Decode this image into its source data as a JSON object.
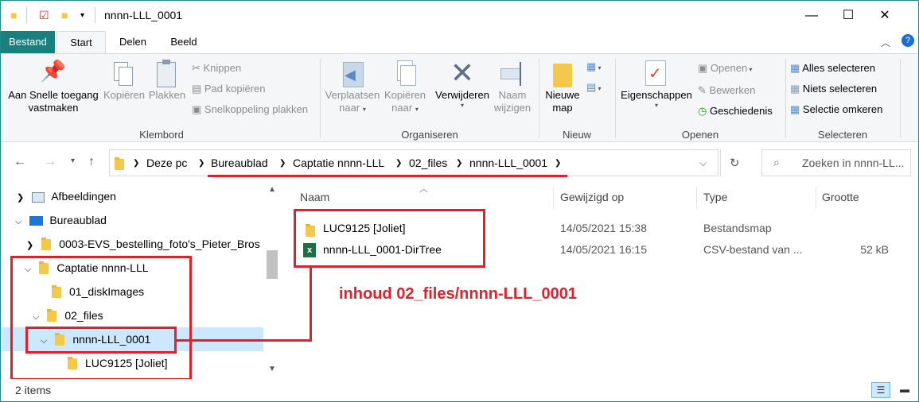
{
  "window": {
    "title": "nnnn-LLL_0001",
    "minimize": "—",
    "maximize": "☐",
    "close": "✕"
  },
  "tabs": [
    "Bestand",
    "Start",
    "Delen",
    "Beeld"
  ],
  "ribbon": {
    "pin": {
      "line1": "Aan Snelle toegang",
      "line2": "vastmaken"
    },
    "copy": "Kopiëren",
    "paste": "Plakken",
    "cut": "Knippen",
    "copy_path": "Pad kopiëren",
    "paste_shortcut": "Snelkoppeling plakken",
    "group_clipboard": "Klembord",
    "move": {
      "line1": "Verplaatsen",
      "line2": "naar"
    },
    "copyto": {
      "line1": "Kopiëren",
      "line2": "naar"
    },
    "delete": "Verwijderen",
    "rename": {
      "line1": "Naam",
      "line2": "wijzigen"
    },
    "group_organise": "Organiseren",
    "new_folder": {
      "line1": "Nieuwe",
      "line2": "map"
    },
    "group_new": "Nieuw",
    "properties": "Eigenschappen",
    "open": "Openen",
    "edit": "Bewerken",
    "history": "Geschiedenis",
    "group_open": "Openen",
    "select_all": "Alles selecteren",
    "select_none": "Niets selecteren",
    "invert": "Selectie omkeren",
    "group_select": "Selecteren"
  },
  "breadcrumb": [
    "Deze pc",
    "Bureaublad",
    "Captatie nnnn-LLL",
    "02_files",
    "nnnn-LLL_0001"
  ],
  "search": {
    "placeholder": "Zoeken in nnnn-LL..."
  },
  "nav": [
    "Afbeeldingen",
    "Bureaublad",
    "0003-EVS_bestelling_foto's_Pieter_Bros",
    "Captatie nnnn-LLL",
    "01_diskImages",
    "02_files",
    "nnnn-LLL_0001",
    "LUC9125 [Joliet]"
  ],
  "columns": {
    "name": "Naam",
    "modified": "Gewijzigd op",
    "type": "Type",
    "size": "Grootte"
  },
  "files": [
    {
      "name": "LUC9125 [Joliet]",
      "modified": "14/05/2021 15:38",
      "type": "Bestandsmap",
      "size": ""
    },
    {
      "name": "nnnn-LLL_0001-DirTree",
      "modified": "14/05/2021 16:15",
      "type": "CSV-bestand van ...",
      "size": "52 kB"
    }
  ],
  "annotation": "inhoud 02_files/nnnn-LLL_0001",
  "status": {
    "items": "2 items"
  },
  "colors": {
    "accent": "#1a7f7f",
    "annotation": "#e0202a",
    "selection": "#cce8ff",
    "folder": "#f3c84b"
  }
}
